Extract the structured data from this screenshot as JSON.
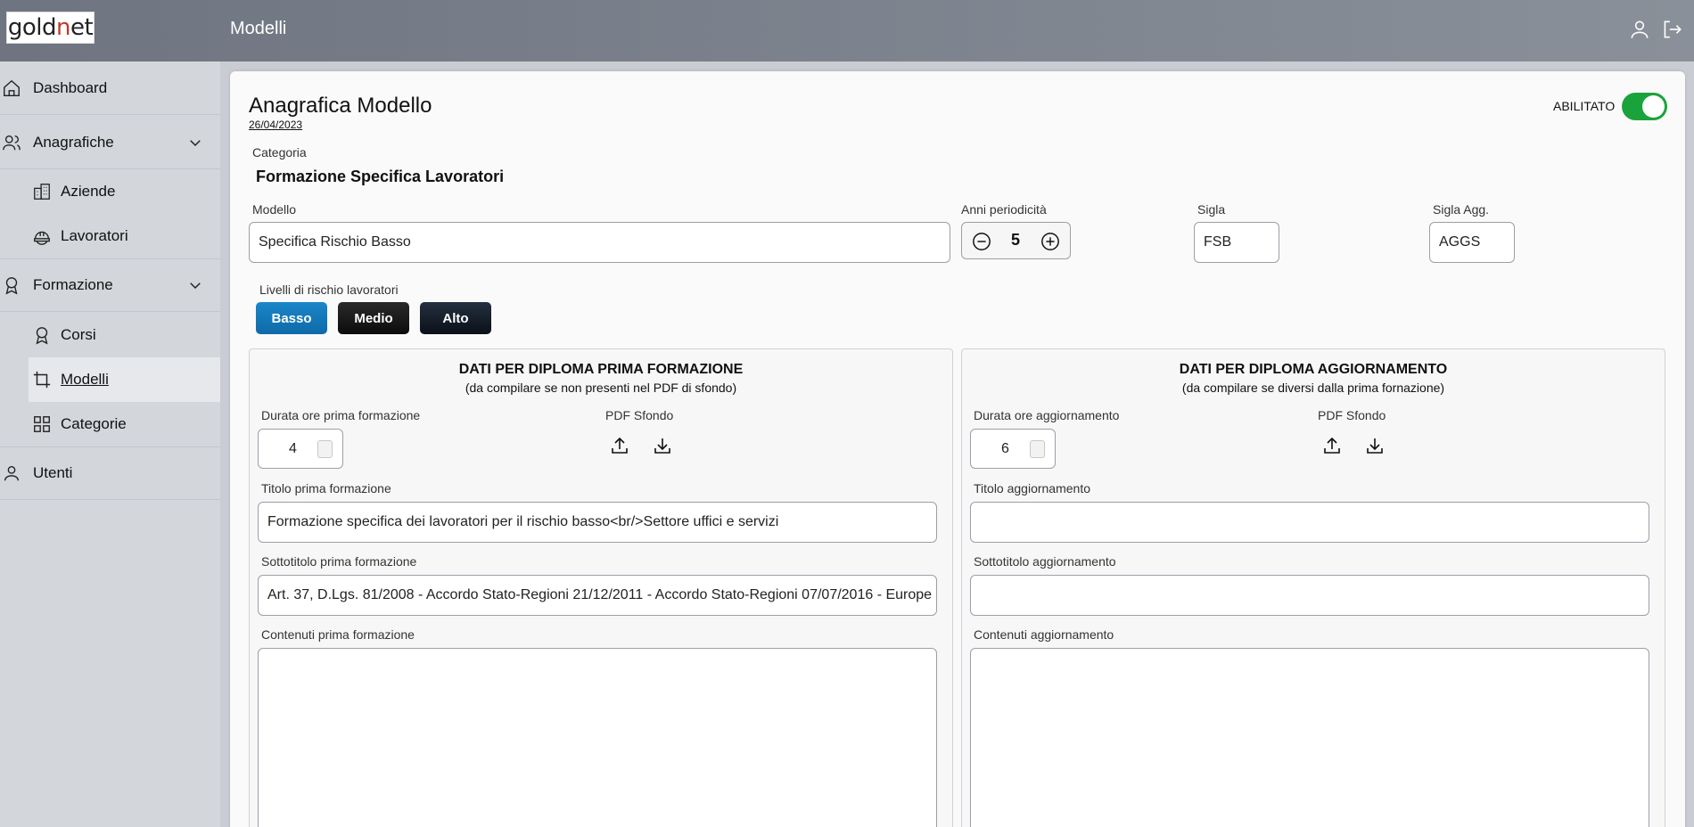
{
  "header": {
    "logo_text_1": "gold",
    "logo_text_2": "n",
    "logo_text_3": "et",
    "title": "Modelli",
    "user_icon": "user-icon",
    "logout_icon": "logout-icon"
  },
  "sidebar": {
    "items": [
      {
        "label": "Dashboard",
        "icon": "home-icon"
      },
      {
        "label": "Anagrafiche",
        "icon": "users-icon"
      },
      {
        "label": "Aziende",
        "icon": "building-icon"
      },
      {
        "label": "Lavoratori",
        "icon": "helmet-icon"
      },
      {
        "label": "Formazione",
        "icon": "award-icon"
      },
      {
        "label": "Corsi",
        "icon": "award-icon"
      },
      {
        "label": "Modelli",
        "icon": "crop-icon"
      },
      {
        "label": "Categorie",
        "icon": "grid-icon"
      },
      {
        "label": "Utenti",
        "icon": "user-icon"
      }
    ],
    "active_item": "Modelli"
  },
  "form": {
    "title": "Anagrafica Modello",
    "date": "26/04/2023",
    "enabled_label": "ABILITATO",
    "enabled": true,
    "category_label": "Categoria",
    "category_value": "Formazione Specifica Lavoratori",
    "model_label": "Modello",
    "model_value": "Specifica Rischio Basso",
    "period_label": "Anni periodicità",
    "period_value": "5",
    "sigla_label": "Sigla",
    "sigla_value": "FSB",
    "sigla_agg_label": "Sigla Agg.",
    "sigla_agg_value": "AGGS",
    "risk_label": "Livelli di rischio lavoratori",
    "risk_levels": [
      "Basso",
      "Medio",
      "Alto"
    ],
    "risk_selected": "Basso",
    "accent_color": "#1a86c8"
  },
  "left_panel": {
    "title": "DATI PER DIPLOMA PRIMA FORMAZIONE",
    "subtitle": "(da compilare se non presenti nel PDF di sfondo)",
    "duration_label": "Durata ore prima formazione",
    "duration_value": "4",
    "pdf_label": "PDF Sfondo",
    "title_label": "Titolo prima formazione",
    "title_value": "Formazione specifica dei lavoratori per il rischio basso<br/>Settore uffici e servizi",
    "subtitle_label": "Sottotitolo prima formazione",
    "subtitle_value": "Art. 37, D.Lgs. 81/2008 - Accordo Stato-Regioni 21/12/2011 - Accordo Stato-Regioni 07/07/2016 - Europe",
    "contents_label": "Contenuti prima formazione",
    "contents_value": ""
  },
  "right_panel": {
    "title": "DATI PER DIPLOMA AGGIORNAMENTO",
    "subtitle": "(da compilare se diversi dalla prima fornazione)",
    "duration_label": "Durata ore aggiornamento",
    "duration_value": "6",
    "pdf_label": "PDF Sfondo",
    "title_label": "Titolo aggiornamento",
    "title_value": "",
    "subtitle_label": "Sottotitolo aggiornamento",
    "subtitle_value": "",
    "contents_label": "Contenuti aggiornamento",
    "contents_value": ""
  }
}
